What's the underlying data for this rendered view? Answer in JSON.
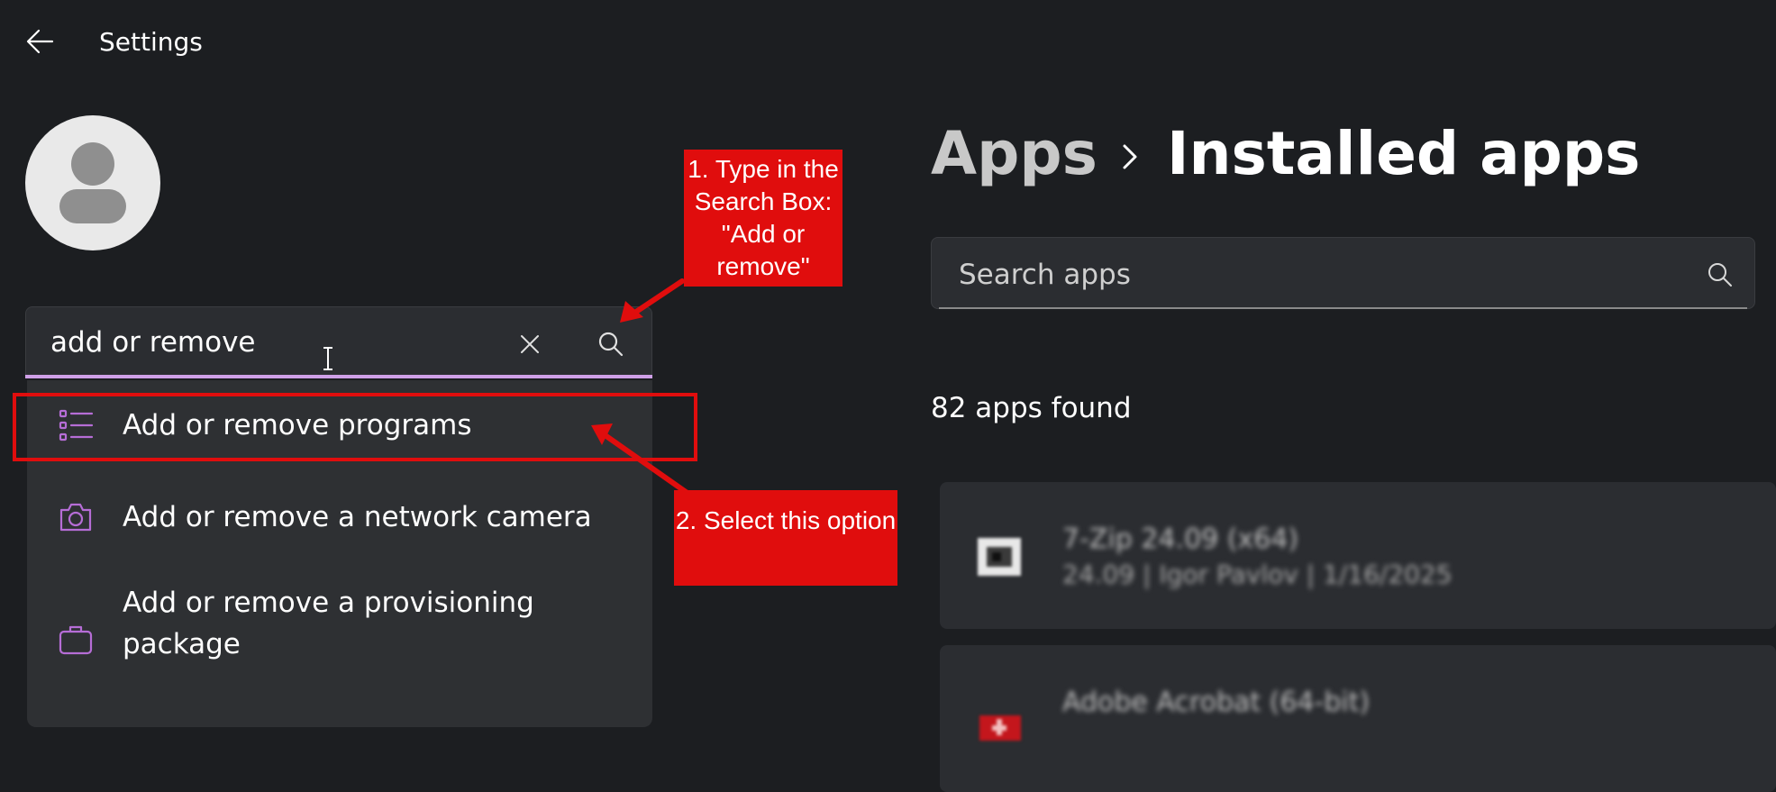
{
  "window": {
    "title": "Settings"
  },
  "left_search": {
    "value": "add or remove",
    "suggestions": [
      {
        "label": "Add or remove programs",
        "icon": "list-icon"
      },
      {
        "label": "Add or remove a network camera",
        "icon": "camera-icon"
      },
      {
        "label": "Add or remove a provisioning package",
        "icon": "briefcase-icon"
      }
    ]
  },
  "breadcrumb": {
    "parent": "Apps",
    "current": "Installed apps"
  },
  "right_search": {
    "placeholder": "Search apps"
  },
  "apps_found": "82 apps found",
  "apps": [
    {
      "name": "7-Zip 24.09 (x64)",
      "meta": "24.09  |  Igor Pavlov  |  1/16/2025",
      "icon_color": "#3a3a3a"
    },
    {
      "name": "Adobe Acrobat (64-bit)",
      "meta": "",
      "icon_color": "#c4161c"
    }
  ],
  "annotations": {
    "step1": "1. Type in the Search Box: \"Add or remove\"",
    "step2": "2. Select this option"
  },
  "colors": {
    "accent": "#cfa0e8",
    "callout_red": "#e00d0d",
    "icon_purple": "#b66dd6",
    "background": "#1c1e21"
  }
}
